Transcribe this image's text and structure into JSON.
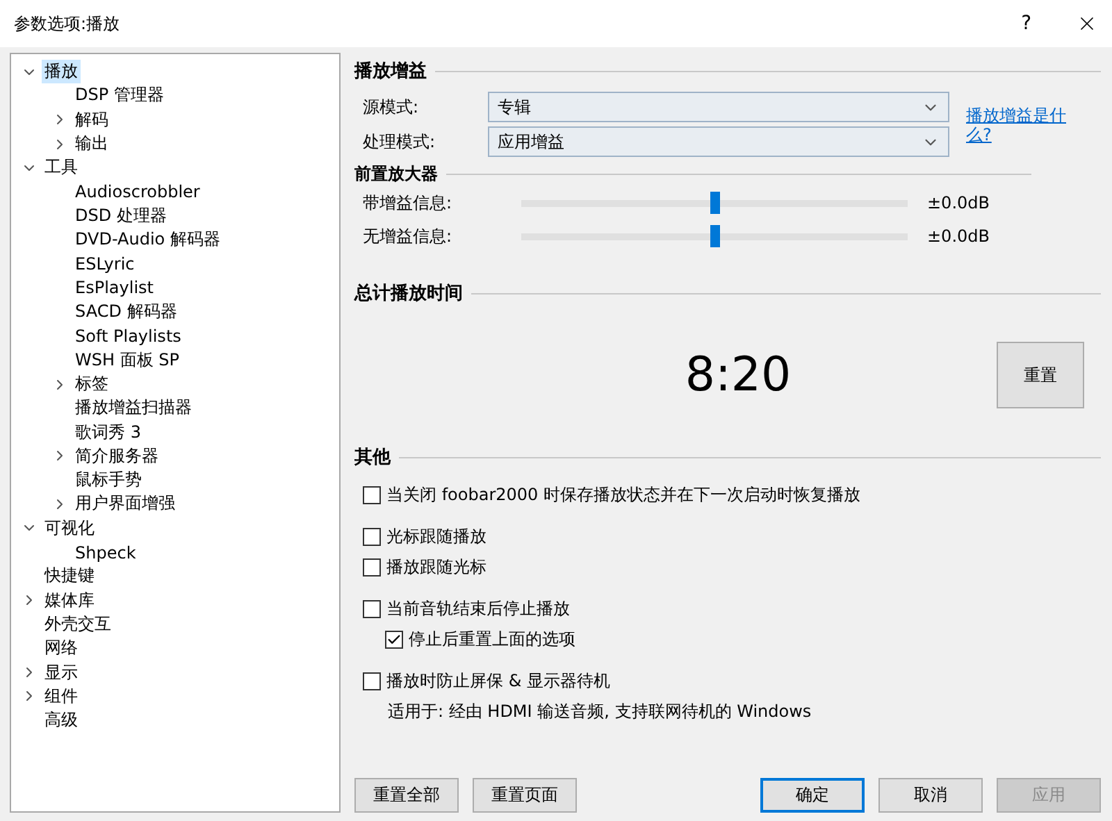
{
  "window": {
    "title": "参数选项:播放",
    "help": "?"
  },
  "tree": [
    {
      "label": "播放",
      "selected": true,
      "expanded": true,
      "children": [
        {
          "label": "DSP 管理器",
          "selected": false
        },
        {
          "label": "解码",
          "selected": false,
          "expanded": false
        },
        {
          "label": "输出",
          "selected": false,
          "expanded": false
        }
      ]
    },
    {
      "label": "工具",
      "selected": false,
      "expanded": true,
      "children": [
        {
          "label": "Audioscrobbler",
          "selected": false
        },
        {
          "label": "DSD 处理器",
          "selected": false
        },
        {
          "label": "DVD-Audio 解码器",
          "selected": false
        },
        {
          "label": "ESLyric",
          "selected": false
        },
        {
          "label": "EsPlaylist",
          "selected": false
        },
        {
          "label": "SACD 解码器",
          "selected": false
        },
        {
          "label": "Soft Playlists",
          "selected": false
        },
        {
          "label": "WSH 面板 SP",
          "selected": false
        },
        {
          "label": "标签",
          "selected": false,
          "expanded": false
        },
        {
          "label": "播放增益扫描器",
          "selected": false
        },
        {
          "label": "歌词秀 3",
          "selected": false
        },
        {
          "label": "简介服务器",
          "selected": false,
          "expanded": false
        },
        {
          "label": "鼠标手势",
          "selected": false
        },
        {
          "label": "用户界面增强",
          "selected": false,
          "expanded": false
        }
      ]
    },
    {
      "label": "可视化",
      "selected": false,
      "expanded": true,
      "children": [
        {
          "label": "Shpeck",
          "selected": false
        }
      ]
    },
    {
      "label": "快捷键",
      "selected": false
    },
    {
      "label": "媒体库",
      "selected": false,
      "expanded": false
    },
    {
      "label": "外壳交互",
      "selected": false
    },
    {
      "label": "网络",
      "selected": false
    },
    {
      "label": "显示",
      "selected": false,
      "expanded": false
    },
    {
      "label": "组件",
      "selected": false,
      "expanded": false
    },
    {
      "label": "高级",
      "selected": false
    }
  ],
  "replaygain": {
    "title": "播放增益",
    "dropdowns": [
      {
        "label": "源模式:",
        "value": "专辑"
      },
      {
        "label": "处理模式:",
        "value": "应用增益"
      }
    ],
    "link": "播放增益是什么?",
    "preamp_title": "前置放大器",
    "sliders": [
      {
        "label": "带增益信息:",
        "level": 0.5,
        "reading": "±0.0dB"
      },
      {
        "label": "无增益信息:",
        "level": 0.5,
        "reading": "±0.0dB"
      }
    ]
  },
  "total_time": {
    "title": "总计播放时间",
    "value": "8:20",
    "reset_button": "重置"
  },
  "other": {
    "title": "其他",
    "groups": [
      [
        {
          "label": "当关闭 foobar2000 时保存播放状态并在下一次启动时恢复播放",
          "checked": false
        }
      ],
      [
        {
          "label": "光标跟随播放",
          "checked": false
        },
        {
          "label": "播放跟随光标",
          "checked": false
        }
      ],
      [
        {
          "label": "当前音轨结束后停止播放",
          "checked": false,
          "children": [
            {
              "label": "停止后重置上面的选项",
              "checked": true
            }
          ]
        }
      ],
      [
        {
          "label": "播放时防止屏保 & 显示器待机",
          "checked": false,
          "note": "适用于: 经由 HDMI 输送音频, 支持联网待机的 Windows"
        }
      ]
    ]
  },
  "buttons_left": [
    {
      "label": "重置全部",
      "disabled": false,
      "default": false
    },
    {
      "label": "重置页面",
      "disabled": false,
      "default": false
    }
  ],
  "buttons_right": [
    {
      "label": "确定",
      "disabled": false,
      "default": true
    },
    {
      "label": "取消",
      "disabled": false,
      "default": false
    },
    {
      "label": "应用",
      "disabled": true,
      "default": false
    }
  ]
}
